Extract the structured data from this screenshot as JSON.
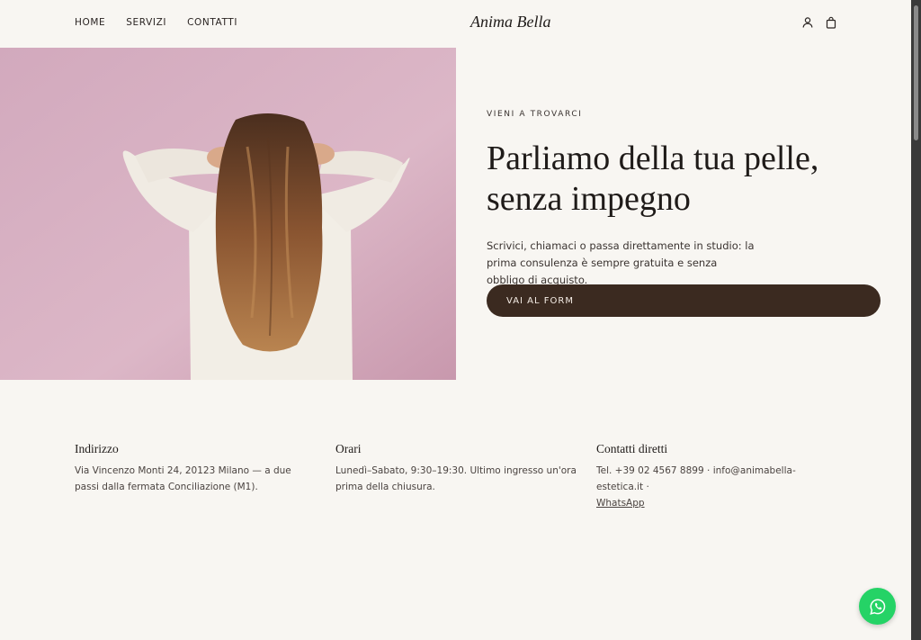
{
  "header": {
    "nav": [
      "HOME",
      "SERVIZI",
      "CONTATTI"
    ],
    "logo": "Anima Bella",
    "icons": [
      "user-icon",
      "shopping-bag-icon"
    ]
  },
  "hero": {
    "eyebrow": "VIENI A TROVARCI",
    "title_line1": "Parliamo della tua pelle,",
    "title_line2": "senza impegno",
    "text": "Scrivici, chiamaci o passa direttamente in studio: la prima consulenza è sempre gratuita e senza obbligo di acquisto.",
    "cta": "VAI AL FORM"
  },
  "info": {
    "address_title": "Indirizzo",
    "address_text": "Via Vincenzo Monti 24, 20123 Milano — a due passi dalla fermata Conciliazione (M1).",
    "hours_title": "Orari",
    "hours_text": "Lunedì–Sabato, 9:30–19:30. Ultimo ingresso un'ora prima della chiusura.",
    "contacts_title": "Contatti diretti",
    "contacts_phone": "Tel. +39 02 4567 8899",
    "contacts_email": "info@animabella-estetica.it",
    "contacts_sep": " · ",
    "contacts_whatsapp": "WhatsApp"
  },
  "colors": {
    "background": "#f8f6f2",
    "cta": "#3b2a20",
    "whatsapp": "#25d366",
    "hero_bg": "#d9b5c5"
  },
  "floating": {
    "icon": "whatsapp-icon"
  }
}
